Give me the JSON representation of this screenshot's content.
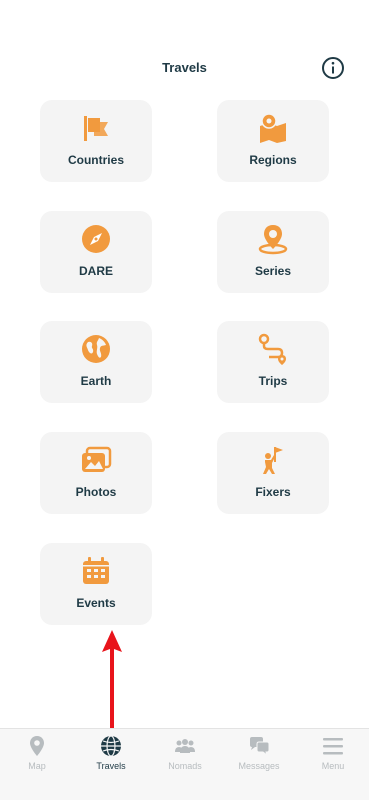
{
  "header": {
    "title": "Travels",
    "info_icon": "info-circle-icon"
  },
  "colors": {
    "accent": "#f19a3e",
    "text": "#1f3a45",
    "tile_bg": "#f4f4f4",
    "tab_inactive": "#b7bcbf",
    "arrow": "#e8141b"
  },
  "tiles": [
    {
      "label": "Countries",
      "icon": "flags-icon"
    },
    {
      "label": "Regions",
      "icon": "map-pin-icon"
    },
    {
      "label": "DARE",
      "icon": "compass-icon"
    },
    {
      "label": "Series",
      "icon": "location-stack-icon"
    },
    {
      "label": "Earth",
      "icon": "globe-icon"
    },
    {
      "label": "Trips",
      "icon": "route-icon"
    },
    {
      "label": "Photos",
      "icon": "photos-icon"
    },
    {
      "label": "Fixers",
      "icon": "climber-flag-icon"
    },
    {
      "label": "Events",
      "icon": "calendar-icon"
    }
  ],
  "tabbar": {
    "active": "Travels",
    "tabs": [
      {
        "label": "Map",
        "icon": "map-pin-icon"
      },
      {
        "label": "Travels",
        "icon": "globe-icon"
      },
      {
        "label": "Nomads",
        "icon": "people-icon"
      },
      {
        "label": "Messages",
        "icon": "chat-bubbles-icon"
      },
      {
        "label": "Menu",
        "icon": "hamburger-menu-icon"
      }
    ]
  }
}
